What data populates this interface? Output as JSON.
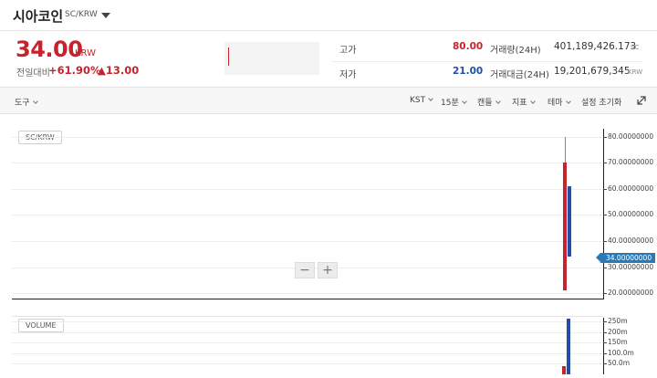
{
  "header": {
    "title": "시아코인",
    "pair": "SC/KRW"
  },
  "summary": {
    "price": "34.00",
    "currency": "KRW",
    "prev_label": "전일대비",
    "change_pct": "+61.90%",
    "change_abs": "▲13.00",
    "high_label": "고가",
    "high_value": "80.00",
    "low_label": "저가",
    "low_value": "21.00",
    "volume_label": "거래량(24H)",
    "volume_value": "401,189,426.173",
    "volume_unit": "SC",
    "amount_label": "거래대금(24H)",
    "amount_value": "19,201,679,345",
    "amount_unit": "KRW"
  },
  "toolbar": {
    "tools": "도구",
    "timezone": "KST",
    "interval": "15분",
    "candle": "캔들",
    "indicator": "지표",
    "theme": "테마",
    "reset": "설정 초기화"
  },
  "colors": {
    "up": "#c8232c",
    "down": "#1f4fa8",
    "accent": "#2a7ab8"
  },
  "chart_data": [
    {
      "type": "candlestick",
      "legend": "SC/KRW",
      "y_ticks": [
        "80.00000000",
        "70.00000000",
        "60.00000000",
        "50.00000000",
        "40.00000000",
        "30.00000000",
        "20.00000000"
      ],
      "ylim": [
        18,
        83
      ],
      "current_value_label": "34.00000000",
      "candles": [
        {
          "open": 21,
          "high": 80,
          "low": 21,
          "close": 70,
          "direction": "up"
        },
        {
          "open": 61,
          "high": 61,
          "low": 34,
          "close": 34,
          "direction": "down"
        }
      ]
    },
    {
      "type": "bar",
      "legend": "VOLUME",
      "y_ticks": [
        "250m",
        "200m",
        "150m",
        "100.0m",
        "50.0m"
      ],
      "ylim": [
        0,
        265
      ],
      "values": [
        {
          "value": 40,
          "direction": "up"
        },
        {
          "value": 265,
          "direction": "down"
        }
      ]
    }
  ]
}
